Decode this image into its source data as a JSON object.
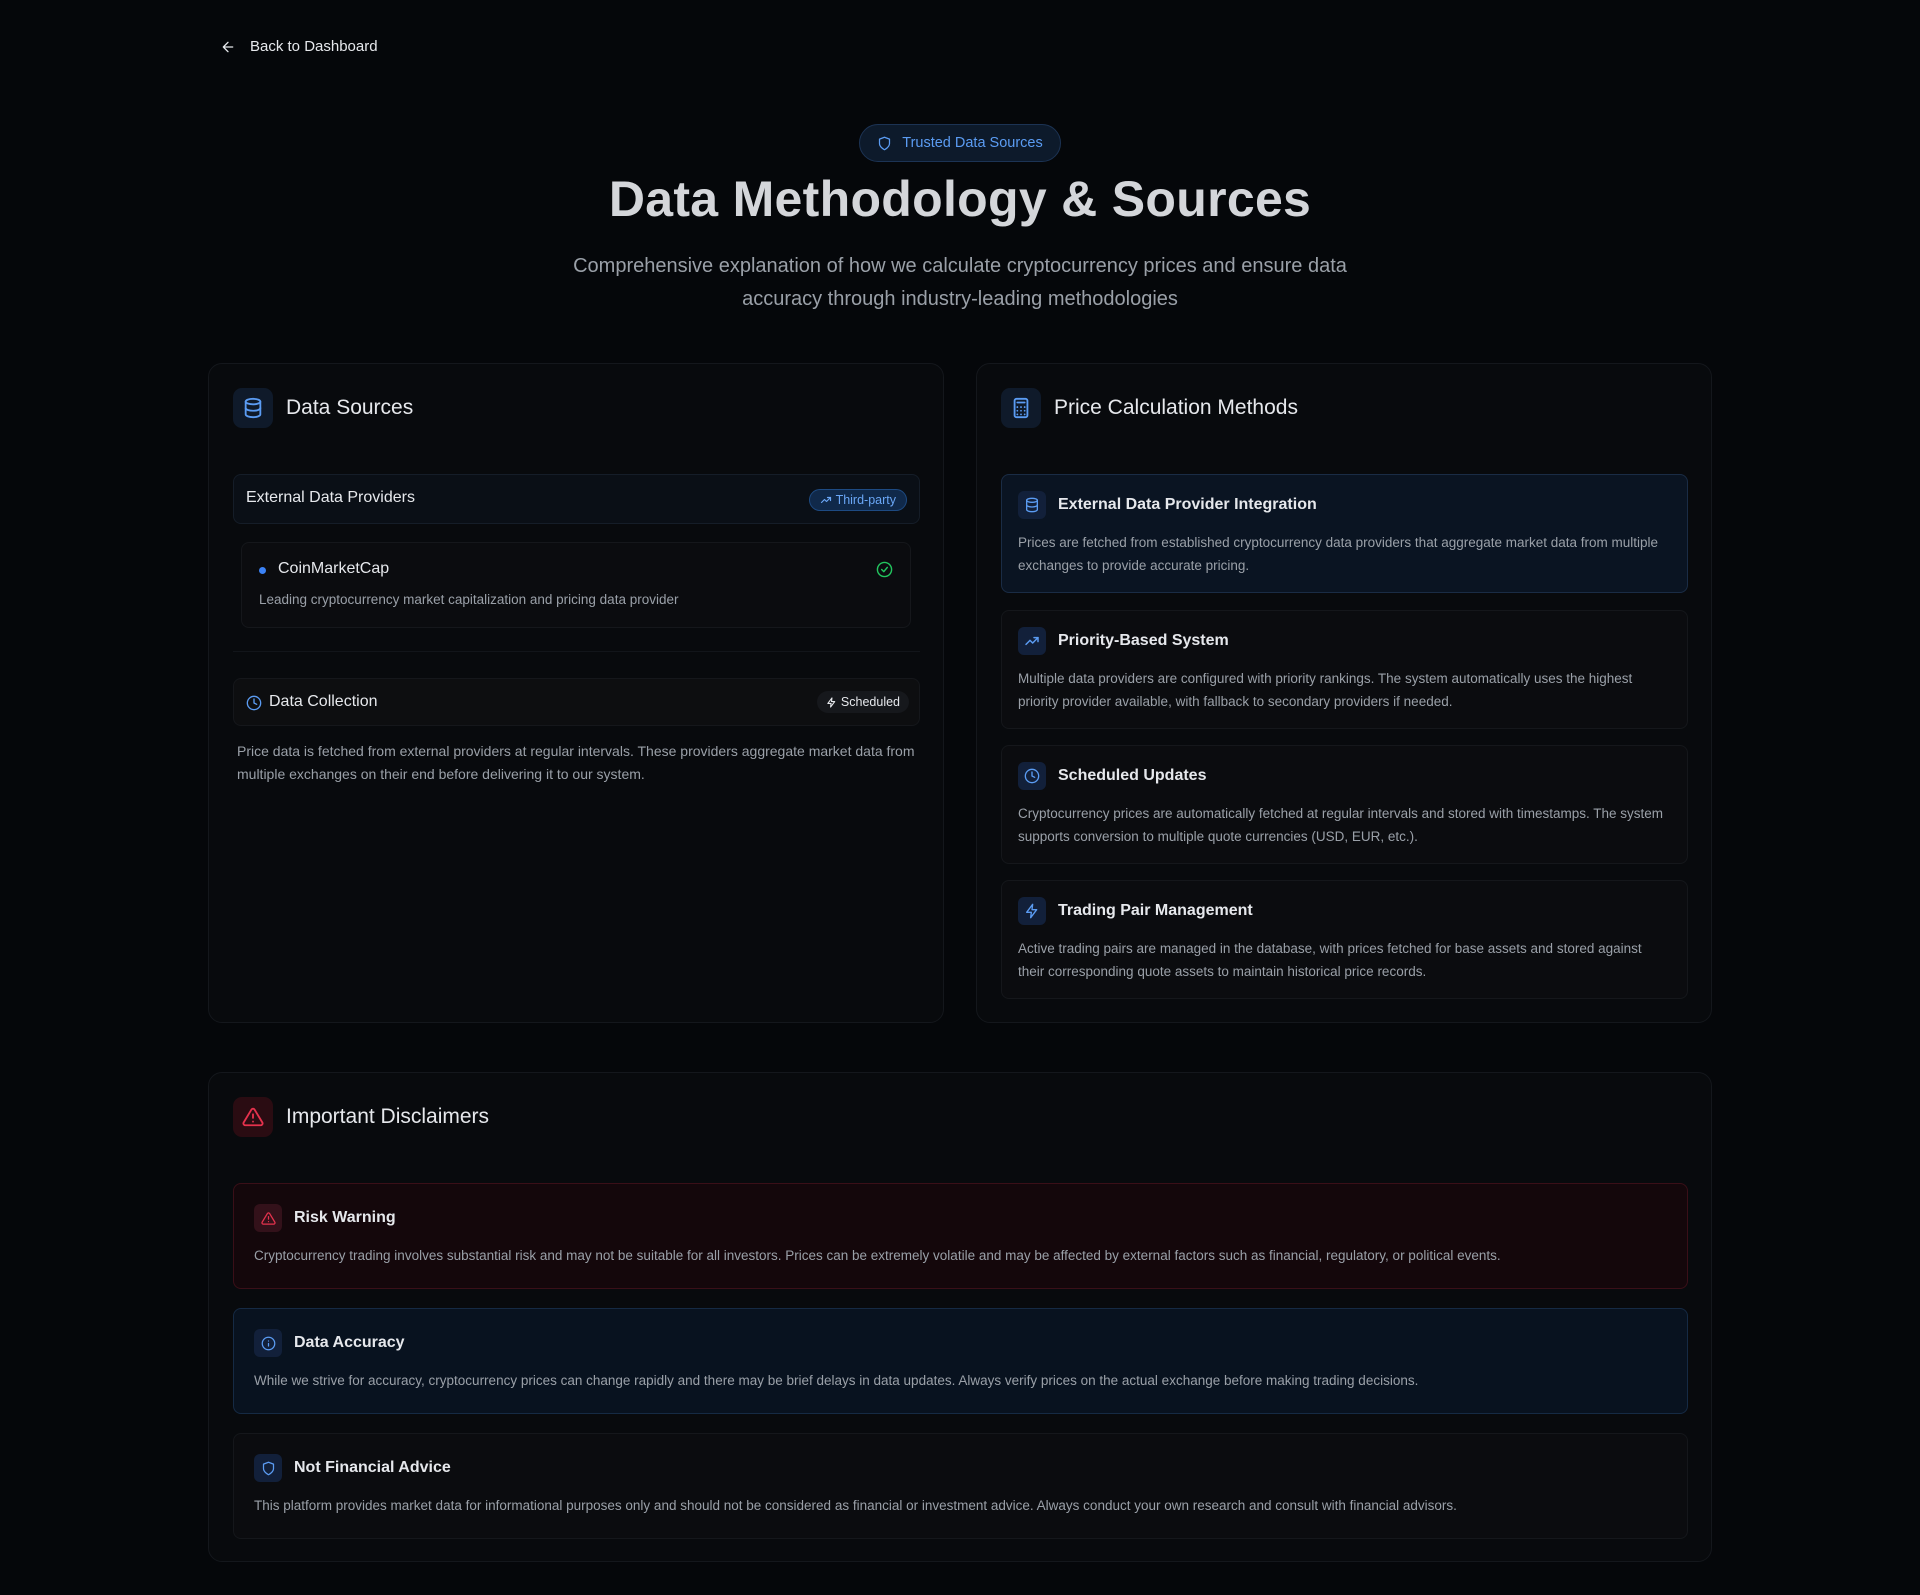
{
  "nav": {
    "back_label": "Back to Dashboard"
  },
  "hero": {
    "badge": "Trusted Data Sources",
    "title": "Data Methodology & Sources",
    "subtitle": "Comprehensive explanation of how we calculate cryptocurrency prices and ensure data accuracy through industry-leading methodologies"
  },
  "data_sources": {
    "title": "Data Sources",
    "providers_label": "External Data Providers",
    "providers_tag": "Third-party",
    "provider": {
      "name": "CoinMarketCap",
      "description": "Leading cryptocurrency market capitalization and pricing data provider"
    },
    "collection_label": "Data Collection",
    "collection_tag": "Scheduled",
    "collection_description": "Price data is fetched from external providers at regular intervals. These providers aggregate market data from multiple exchanges on their end before delivering it to our system."
  },
  "methods": {
    "title": "Price Calculation Methods",
    "items": [
      {
        "title": "External Data Provider Integration",
        "description": "Prices are fetched from established cryptocurrency data providers that aggregate market data from multiple exchanges to provide accurate pricing.",
        "icon": "database-icon"
      },
      {
        "title": "Priority-Based System",
        "description": "Multiple data providers are configured with priority rankings. The system automatically uses the highest priority provider available, with fallback to secondary providers if needed.",
        "icon": "trending-up-icon"
      },
      {
        "title": "Scheduled Updates",
        "description": "Cryptocurrency prices are automatically fetched at regular intervals and stored with timestamps. The system supports conversion to multiple quote currencies (USD, EUR, etc.).",
        "icon": "clock-icon"
      },
      {
        "title": "Trading Pair Management",
        "description": "Active trading pairs are managed in the database, with prices fetched for base assets and stored against their corresponding quote assets to maintain historical price records.",
        "icon": "lightning-icon"
      }
    ]
  },
  "disclaimers": {
    "title": "Important Disclaimers",
    "items": [
      {
        "title": "Risk Warning",
        "description": "Cryptocurrency trading involves substantial risk and may not be suitable for all investors. Prices can be extremely volatile and may be affected by external factors such as financial, regulatory, or political events.",
        "icon": "warning-icon"
      },
      {
        "title": "Data Accuracy",
        "description": "While we strive for accuracy, cryptocurrency prices can change rapidly and there may be brief delays in data updates. Always verify prices on the actual exchange before making trading decisions.",
        "icon": "info-icon"
      },
      {
        "title": "Not Financial Advice",
        "description": "This platform provides market data for informational purposes only and should not be considered as financial or investment advice. Always conduct your own research and consult with financial advisors.",
        "icon": "shield-icon"
      }
    ]
  },
  "colors": {
    "accent": "#5b9cf3",
    "danger": "#e5324d",
    "success": "#22c55e",
    "background": "#05070a"
  }
}
